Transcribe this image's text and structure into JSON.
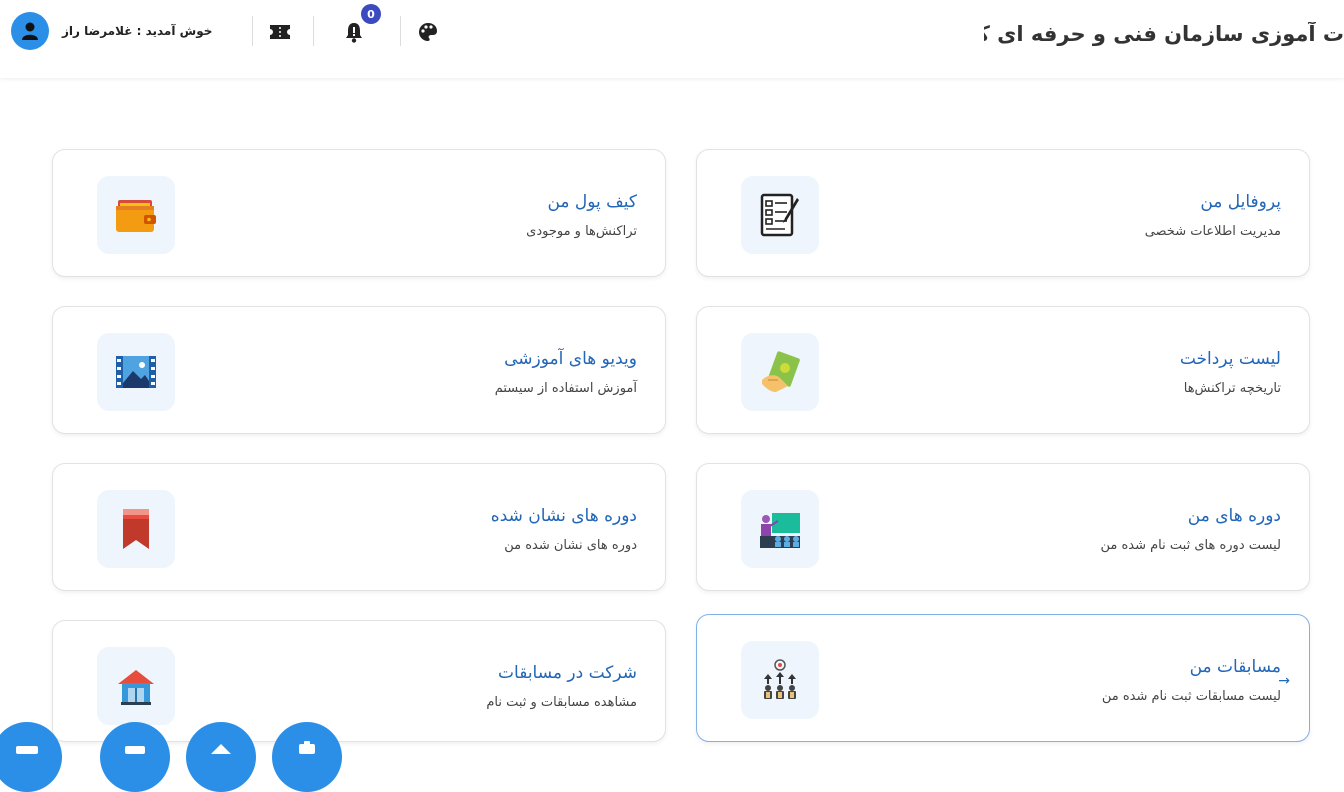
{
  "header": {
    "site_title": "سامانه آموزش الکترونیک مراکز آموزش فنی و حرفه ای سازمان آموزش فنی و حرفه ای کشور",
    "site_title_visible": "ت آموزی سازمان فنی و حرفه ای کشور",
    "welcome": "خوش آمدید : غلامرضا راز",
    "notification_count": "0",
    "icons": [
      "user-icon",
      "ticket-icon",
      "bell-icon",
      "palette-icon"
    ]
  },
  "cards": [
    {
      "title": "پروفایل من",
      "subtitle": "مدیریت اطلاعات شخصی",
      "icon": "profile-form-icon"
    },
    {
      "title": "کیف پول من",
      "subtitle": "تراکنش‌ها و موجودی",
      "icon": "wallet-icon"
    },
    {
      "title": "لیست پرداخت",
      "subtitle": "تاریخچه تراکنش‌ها",
      "icon": "payment-hand-icon"
    },
    {
      "title": "ویدیو های آموزشی",
      "subtitle": "آموزش استفاده از سیستم",
      "icon": "video-icon"
    },
    {
      "title": "دوره های من",
      "subtitle": "لیست دوره های ثبت نام شده من",
      "icon": "classroom-icon"
    },
    {
      "title": "دوره های نشان شده",
      "subtitle": "دوره های نشان شده من",
      "icon": "bookmark-icon"
    },
    {
      "title": "مسابقات من",
      "subtitle": "لیست مسابقات ثبت نام شده من",
      "icon": "competition-icon",
      "arrow": "→"
    },
    {
      "title": "شرکت در مسابقات",
      "subtitle": "مشاهده مسابقات و ثبت نام",
      "icon": "school-house-icon"
    }
  ],
  "colors": {
    "accent": "#2b8fe8",
    "title_blue": "#2266b8",
    "badge": "#3b4bbf"
  }
}
